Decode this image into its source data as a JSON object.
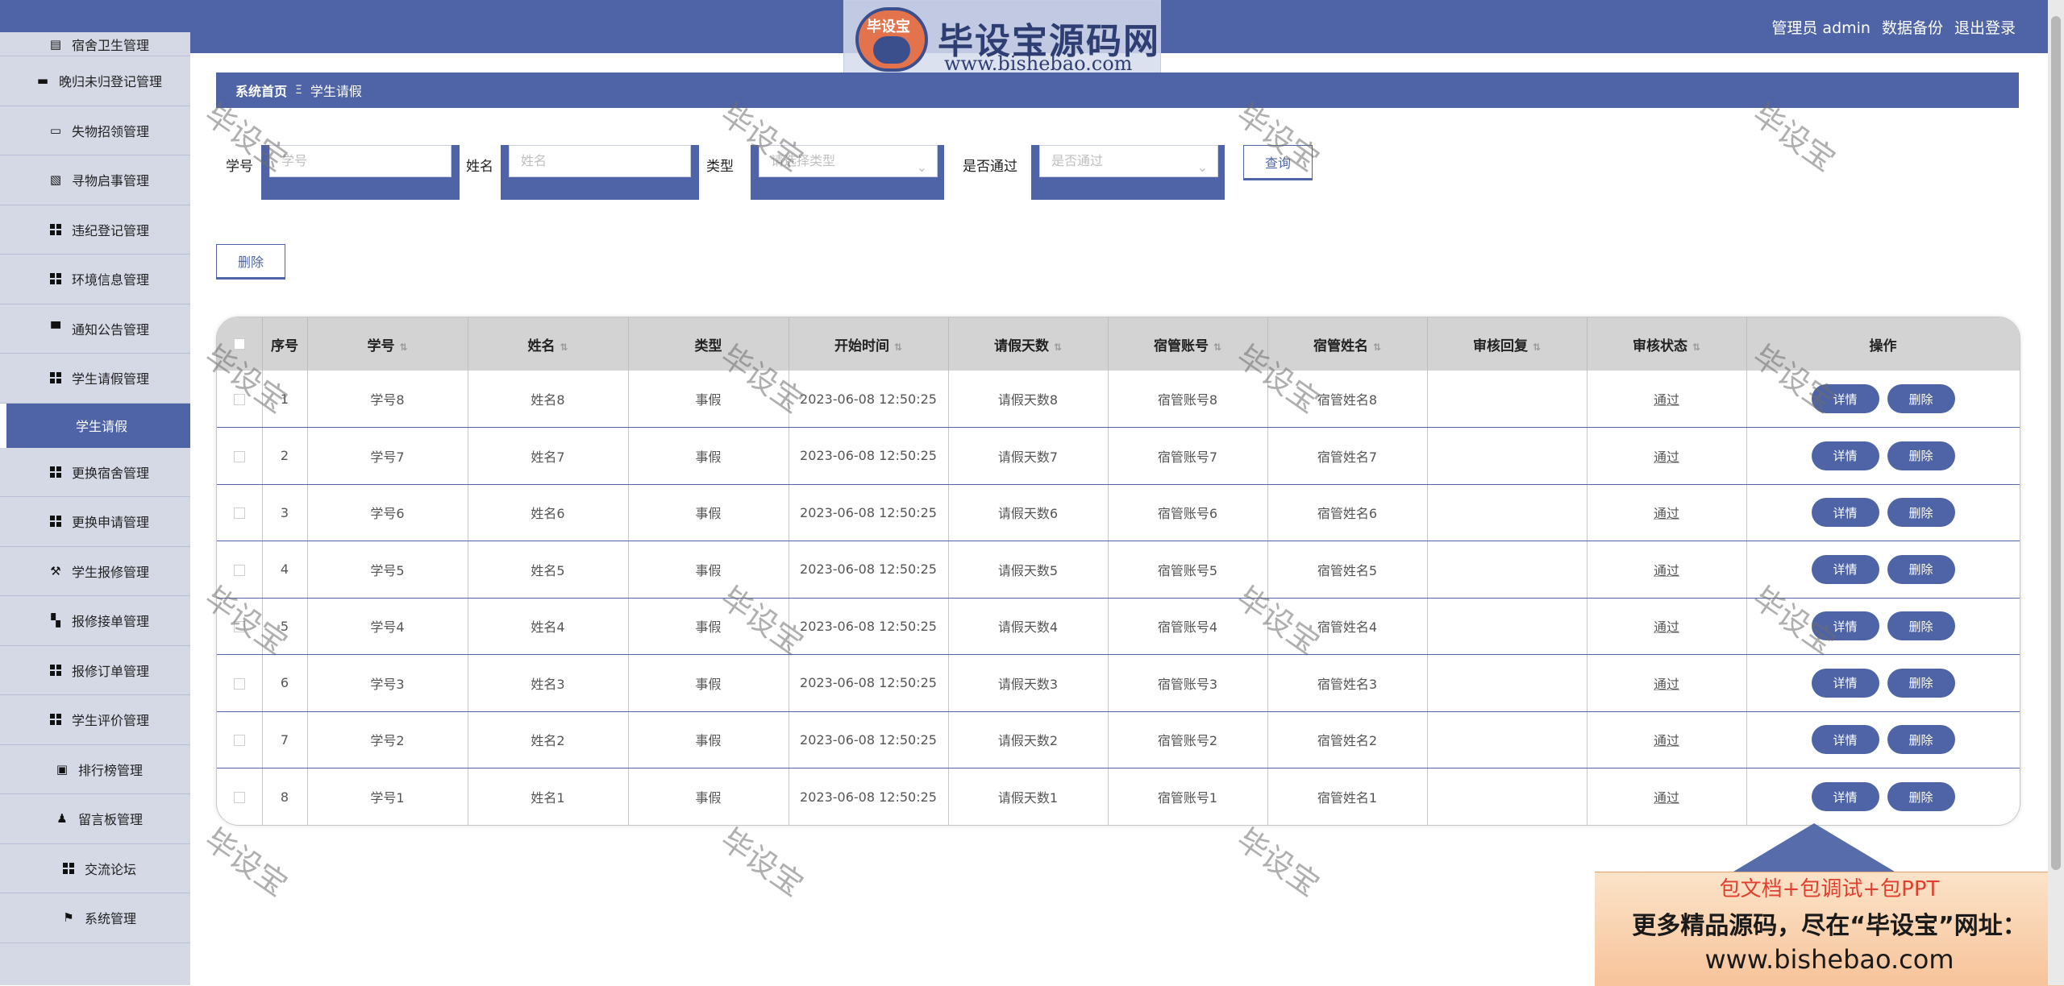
{
  "logo": {
    "badge_text": "毕设宝",
    "title": "毕设宝源码网",
    "url": "www.bishebao.com"
  },
  "header": {
    "user": "管理员 admin",
    "backup": "数据备份",
    "logout": "退出登录"
  },
  "sidebar": {
    "items": [
      {
        "label": "宿舍卫生管理",
        "icon": "clipboard-icon"
      },
      {
        "label": "晚归未归登记管理",
        "icon": "chat-icon"
      },
      {
        "label": "失物招领管理",
        "icon": "card-icon"
      },
      {
        "label": "寻物启事管理",
        "icon": "clipboard-x-icon"
      },
      {
        "label": "违纪登记管理",
        "icon": "grid-icon"
      },
      {
        "label": "环境信息管理",
        "icon": "grid-icon"
      },
      {
        "label": "通知公告管理",
        "icon": "monitor-icon"
      },
      {
        "label": "学生请假管理",
        "icon": "grid-icon"
      }
    ],
    "active_sub": "学生请假",
    "items_after": [
      {
        "label": "更换宿舍管理",
        "icon": "grid-icon"
      },
      {
        "label": "更换申请管理",
        "icon": "grid-icon"
      },
      {
        "label": "学生报修管理",
        "icon": "wrench-icon"
      },
      {
        "label": "报修接单管理",
        "icon": "ticket-icon"
      },
      {
        "label": "报修订单管理",
        "icon": "grid-icon"
      },
      {
        "label": "学生评价管理",
        "icon": "grid-icon"
      },
      {
        "label": "排行榜管理",
        "icon": "clipboard-check-icon"
      },
      {
        "label": "留言板管理",
        "icon": "user-icon"
      },
      {
        "label": "交流论坛",
        "icon": "grid-icon"
      },
      {
        "label": "系统管理",
        "icon": "flag-icon"
      }
    ]
  },
  "breadcrumb": {
    "home": "系统首页",
    "separator": "Ξ",
    "current": "学生请假"
  },
  "search": {
    "student_no_label": "学号",
    "student_no_placeholder": "学号",
    "name_label": "姓名",
    "name_placeholder": "姓名",
    "type_label": "类型",
    "type_placeholder": "请选择类型",
    "passed_label": "是否通过",
    "passed_placeholder": "是否通过",
    "query_label": "查询"
  },
  "actions": {
    "delete_label": "删除"
  },
  "table": {
    "headers": [
      "序号",
      "学号",
      "姓名",
      "类型",
      "开始时间",
      "请假天数",
      "宿管账号",
      "宿管姓名",
      "审核回复",
      "审核状态",
      "操作"
    ],
    "detail_label": "详情",
    "delete_label": "删除",
    "rows": [
      {
        "no": "1",
        "student_no": "学号8",
        "name": "姓名8",
        "type": "事假",
        "start": "2023-06-08 12:50:25",
        "days": "请假天数8",
        "account": "宿管账号8",
        "manager": "宿管姓名8",
        "reply": "",
        "status": "通过"
      },
      {
        "no": "2",
        "student_no": "学号7",
        "name": "姓名7",
        "type": "事假",
        "start": "2023-06-08 12:50:25",
        "days": "请假天数7",
        "account": "宿管账号7",
        "manager": "宿管姓名7",
        "reply": "",
        "status": "通过"
      },
      {
        "no": "3",
        "student_no": "学号6",
        "name": "姓名6",
        "type": "事假",
        "start": "2023-06-08 12:50:25",
        "days": "请假天数6",
        "account": "宿管账号6",
        "manager": "宿管姓名6",
        "reply": "",
        "status": "通过"
      },
      {
        "no": "4",
        "student_no": "学号5",
        "name": "姓名5",
        "type": "事假",
        "start": "2023-06-08 12:50:25",
        "days": "请假天数5",
        "account": "宿管账号5",
        "manager": "宿管姓名5",
        "reply": "",
        "status": "通过"
      },
      {
        "no": "5",
        "student_no": "学号4",
        "name": "姓名4",
        "type": "事假",
        "start": "2023-06-08 12:50:25",
        "days": "请假天数4",
        "account": "宿管账号4",
        "manager": "宿管姓名4",
        "reply": "",
        "status": "通过"
      },
      {
        "no": "6",
        "student_no": "学号3",
        "name": "姓名3",
        "type": "事假",
        "start": "2023-06-08 12:50:25",
        "days": "请假天数3",
        "account": "宿管账号3",
        "manager": "宿管姓名3",
        "reply": "",
        "status": "通过"
      },
      {
        "no": "7",
        "student_no": "学号2",
        "name": "姓名2",
        "type": "事假",
        "start": "2023-06-08 12:50:25",
        "days": "请假天数2",
        "account": "宿管账号2",
        "manager": "宿管姓名2",
        "reply": "",
        "status": "通过"
      },
      {
        "no": "8",
        "student_no": "学号1",
        "name": "姓名1",
        "type": "事假",
        "start": "2023-06-08 12:50:25",
        "days": "请假天数1",
        "account": "宿管账号1",
        "manager": "宿管姓名1",
        "reply": "",
        "status": "通过"
      }
    ]
  },
  "watermark": "毕设宝",
  "ad": {
    "line1": "包文档+包调试+包PPT",
    "line2": "更多精品源码，尽在“毕设宝”网址：",
    "line3": "www.bishebao.com"
  }
}
